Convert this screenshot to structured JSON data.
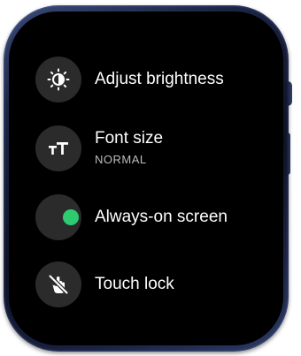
{
  "menu": {
    "items": [
      {
        "label": "Adjust brightness",
        "icon": "brightness-icon"
      },
      {
        "label": "Font size",
        "sublabel": "NORMAL",
        "icon": "font-size-icon"
      },
      {
        "label": "Always-on screen",
        "icon": "toggle-knob",
        "toggle_on": true
      },
      {
        "label": "Touch lock",
        "icon": "touch-lock-icon"
      }
    ]
  },
  "colors": {
    "screen_background": "#000000",
    "icon_background": "#2b2b2b",
    "toggle_on": "#2ecc71",
    "text_primary": "#ffffff",
    "text_secondary": "#bdbdbd",
    "watch_case": "#1c2546"
  }
}
